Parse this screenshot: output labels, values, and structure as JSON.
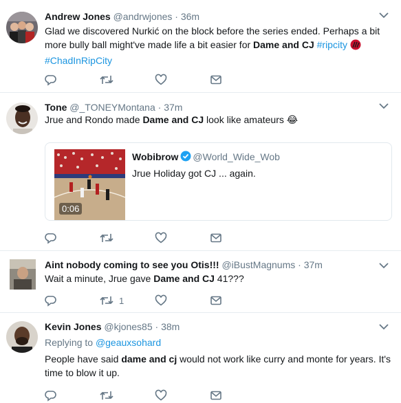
{
  "tweets": [
    {
      "name": "Andrew Jones",
      "handle": "@andrwjones",
      "dot": "·",
      "time": "36m",
      "text_parts": [
        "Glad we discovered Nurkić on the block before the series ended. Perhaps a bit more bully ball might've made life a bit easier for ",
        "Dame and CJ",
        " ",
        "#ripcity",
        "#ChadInRipCity"
      ],
      "avatar_icon": "user-photo-andrew"
    },
    {
      "name": "Tone",
      "handle": "@_TONEYMontana",
      "dot": "·",
      "time": "37m",
      "text_parts": [
        "Jrue and Rondo made ",
        "Dame and CJ",
        " look like amateurs ",
        "😂"
      ],
      "quote": {
        "name": "Wobibrow",
        "handle": "@World_Wide_Wob",
        "text": "Jrue Holiday got CJ ... again.",
        "duration": "0:06"
      }
    },
    {
      "name": "Aint nobody coming to see you Otis!!!",
      "handle": "@iBustMagnums",
      "dot": "·",
      "time": "37m",
      "text_parts": [
        "Wait a minute, Jrue gave ",
        "Dame and CJ",
        " 41???"
      ],
      "retweet_count": "1"
    },
    {
      "name": "Kevin Jones",
      "handle": "@kjones85",
      "dot": "·",
      "time": "38m",
      "replying_prefix": "Replying to ",
      "replying_to": "@geauxsohard",
      "text_parts": [
        "People have said ",
        "dame and cj",
        " would not work like curry and monte for years. It's time to blow it up."
      ]
    }
  ],
  "colors": {
    "link": "#1b95e0",
    "muted": "#657786",
    "divider": "#e6ecf0"
  }
}
